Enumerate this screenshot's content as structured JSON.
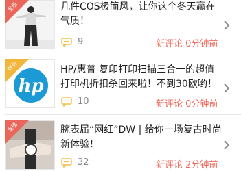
{
  "feed": {
    "items": [
      {
        "badge": "发现",
        "title": "几件COS极简风，让你这个冬天赢在气质！",
        "count": "9",
        "time": "新评论 0分钟前",
        "badge_color": "#e9675a"
      },
      {
        "badge": "好价",
        "title": "HP/惠普 复印打印扫描三合一的超值打印机折扣杀回来啦！不到30欧哟！",
        "count": "10",
        "time": "新评论 0分钟前",
        "badge_color": "#f2b63b"
      },
      {
        "badge": "发现",
        "title": "腕表届“网红”DW | 给你一场复古时尚新体验！",
        "count": "32",
        "time": "新评论 2分钟前",
        "badge_color": "#e9675a"
      }
    ]
  },
  "colors": {
    "accent": "#f06a5a",
    "badge_red": "#e9675a",
    "badge_yellow": "#f2b63b",
    "hp_blue": "#1c9ad6"
  },
  "icons": {
    "comment": "comment-bubble-icon",
    "chevron": "chevron-right-icon"
  }
}
